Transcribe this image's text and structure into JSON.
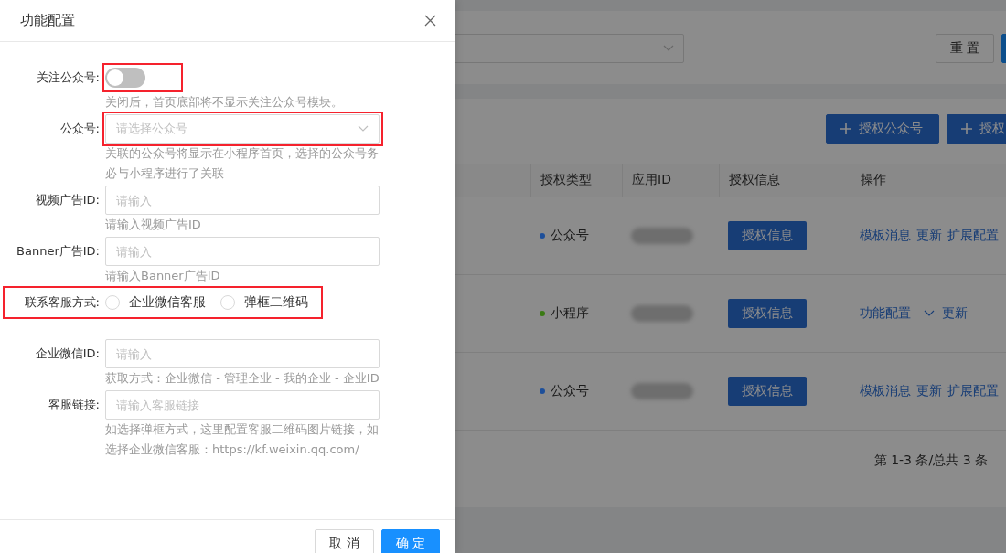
{
  "background": {
    "filter": {
      "reset_button": "重 置"
    },
    "toolbar": [
      "授权公众号",
      "授权"
    ],
    "table": {
      "columns": [
        "授权类型",
        "应用ID",
        "授权信息",
        "操作"
      ],
      "rows": [
        {
          "type": "公众号",
          "color": "#1d4f9a",
          "info_button": "授权信息",
          "actions": [
            {
              "kind": "link",
              "label": "模板消息"
            },
            {
              "kind": "link",
              "label": "更新"
            },
            {
              "kind": "link",
              "label": "扩展配置"
            }
          ]
        },
        {
          "type": "小程序",
          "color": "#3a7a14",
          "info_button": "授权信息",
          "actions": [
            {
              "kind": "link",
              "label": "功能配置"
            },
            {
              "kind": "chevron"
            },
            {
              "kind": "link",
              "label": "更新"
            }
          ]
        },
        {
          "type": "公众号",
          "color": "#1d4f9a",
          "info_button": "授权信息",
          "actions": [
            {
              "kind": "link",
              "label": "模板消息"
            },
            {
              "kind": "link",
              "label": "更新"
            },
            {
              "kind": "link",
              "label": "扩展配置"
            }
          ]
        }
      ]
    },
    "pagination": "第 1-3 条/总共 3 条"
  },
  "drawer": {
    "title": "功能配置",
    "fields": [
      {
        "kind": "switch",
        "label": "关注公众号:",
        "on": false,
        "highlighted": true,
        "help": "关闭后，首页底部将不显示关注公众号模块。"
      },
      {
        "kind": "select",
        "label": "公众号:",
        "placeholder": "请选择公众号",
        "highlighted": true,
        "help": "关联的公众号将显示在小程序首页，选择的公众号务必与小程序进行了关联"
      },
      {
        "kind": "input",
        "label": "视频广告ID:",
        "placeholder": "请输入",
        "help": "请输入视频广告ID"
      },
      {
        "kind": "input",
        "label": "Banner广告ID:",
        "placeholder": "请输入",
        "help": "请输入Banner广告ID"
      },
      {
        "kind": "radio",
        "label": "联系客服方式:",
        "highlighted": true,
        "options": [
          {
            "label": "企业微信客服",
            "selected": false
          },
          {
            "label": "弹框二维码",
            "selected": false
          }
        ]
      },
      {
        "kind": "input",
        "label": "企业微信ID:",
        "placeholder": "请输入",
        "help": "获取方式：企业微信 - 管理企业 - 我的企业 - 企业ID"
      },
      {
        "kind": "input",
        "label": "客服链接:",
        "placeholder": "请输入客服链接",
        "help": "如选择弹框方式，这里配置客服二维码图片链接，如选择企业微信客服：https://kf.weixin.qq.com/"
      }
    ],
    "buttons": [
      {
        "kind": "default",
        "label": "取 消"
      },
      {
        "kind": "primary",
        "label": "确 定"
      }
    ]
  }
}
